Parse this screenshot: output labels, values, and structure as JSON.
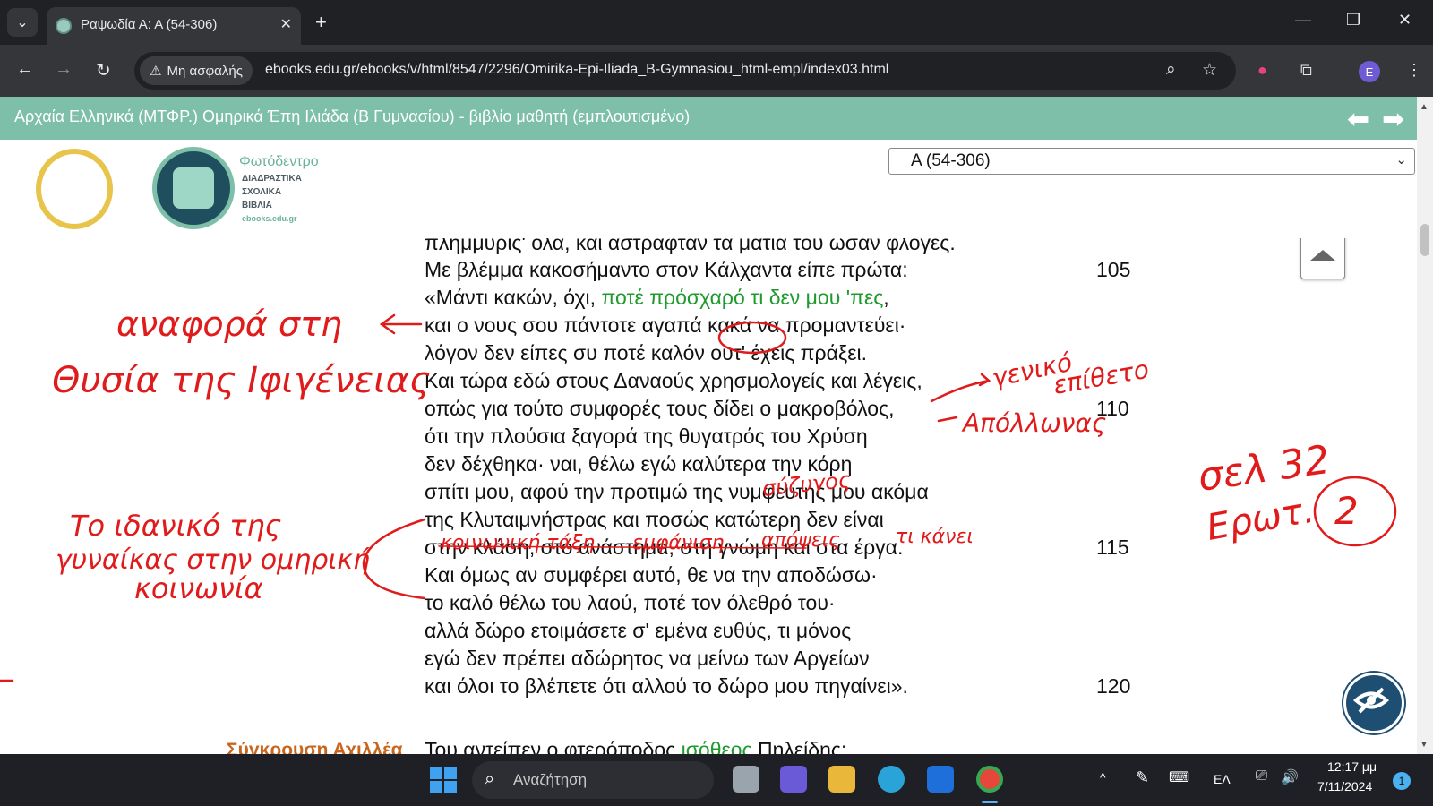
{
  "browser": {
    "tab_title": "Ραψωδία Α: Α (54-306)",
    "new_tab_symbol": "+",
    "security_label": "Μη ασφαλής",
    "url": "ebooks.edu.gr/ebooks/v/html/8547/2296/Omirika-Epi-Iliada_B-Gymnasiou_html-empl/index03.html",
    "profile_initial": "E"
  },
  "book": {
    "title": "Αρχαία Ελληνικά (ΜΤΦΡ.) Ομηρικά Έπη Ιλιάδα (Β Γυμνασίου) - βιβλίο μαθητή (εμπλουτισμένο)",
    "logo_title": "Φωτόδεντρο",
    "logo_sub1": "ΔΙΑΔΡΑΣΤΙΚΑ",
    "logo_sub2": "ΣΧΟΛΙΚΑ",
    "logo_sub3": "ΒΙΒΛΙΑ",
    "logo_sub4": "ebooks.edu.gr",
    "chapter_select": "Α (54-306)"
  },
  "verses": [
    {
      "text": "πλημμυρίς' όλα, και αστράφταν τα μάτια του ωσάν φλογές.",
      "num": ""
    },
    {
      "text": "Με βλέμμα κακοσήμαντο στον Κάλχαντα είπε πρώτα:",
      "num": "105"
    },
    {
      "pre": "«Μάντι κακών, όχι, ",
      "green": "ποτέ πρόσχαρό τι δεν μου 'πες",
      "post": ",",
      "num": ""
    },
    {
      "text": "και ο νους σου πάντοτε αγαπά κακά να προμαντεύει·",
      "num": ""
    },
    {
      "text": "λόγον δεν είπες συ ποτέ καλόν ουτ' έχεις πράξει.",
      "num": ""
    },
    {
      "text": "Και τώρα εδώ στους Δαναούς χρησμολογείς και λέγεις,",
      "num": ""
    },
    {
      "text": "οπώς για τούτο συμφορές τους δίδει ο μακροβόλος,",
      "num": "110"
    },
    {
      "text": "ότι την πλούσια ξαγορά της θυγατρός του Χρύση",
      "num": ""
    },
    {
      "text": "δεν δέχθηκα· ναι, θέλω εγώ καλύτερα την κόρη",
      "num": ""
    },
    {
      "text": "σπίτι μου, αφού την προτιμώ της νυμφευτής μου ακόμα",
      "num": ""
    },
    {
      "text": "της Κλυταιμνήστρας και ποσώς κατώτερη δεν είναι",
      "num": ""
    },
    {
      "text": "στην κλάση, στο ανάστημα, στη γνώμη και στα έργα.",
      "num": "115"
    },
    {
      "text": "Και όμως αν συμφέρει αυτό, θε να την αποδώσω·",
      "num": ""
    },
    {
      "text": "το καλό θέλω του λαού, ποτέ τον όλεθρό του·",
      "num": ""
    },
    {
      "text": "αλλά δώρο ετοιμάσετε σ' εμένα ευθύς, τι μόνος",
      "num": ""
    },
    {
      "text": "εγώ δεν πρέπει αδώρητος να μείνω των Αργείων",
      "num": ""
    },
    {
      "text": "και όλοι το βλέπετε ότι αλλού το δώρο μου πηγαίνει».",
      "num": "120"
    },
    {
      "pre": "Του αντείπεν ο φτερόποδος ",
      "green": "ισόθεος",
      "post": " Πηλείδης:",
      "num": ""
    }
  ],
  "section_label": "Σύγκρουση Αχιλλέα",
  "annotations": {
    "note1_line1": "αναφορά στη",
    "note1_line2": "Θυσία της Ιφιγένειας",
    "note2_line1": "γενικό",
    "note2_line2": "επίθετο",
    "note2_line3": "Απόλλωνας",
    "note3_line1": "σελ 32",
    "note3_line2": "Ερωτ.",
    "note3_num": "2",
    "note4": "σύζυγος",
    "note5_line1": "Το ιδανικό της",
    "note5_line2": "γυναίκας στην ομηρική",
    "note5_line3": "κοινωνία",
    "note6_a": "κοινωνική τάξη",
    "note6_b": "εμφάνιση",
    "note6_c": "απόψεις",
    "note6_d": "τι κάνει"
  },
  "taskbar": {
    "search_placeholder": "Αναζήτηση",
    "language": "ΕΛ",
    "time": "12:17 μμ",
    "date": "7/11/2024",
    "notification_count": "1"
  },
  "colors": {
    "header_green": "#7dbfa9",
    "ink_red": "#e01b1b",
    "link_green": "#1f9a2e",
    "section_orange": "#c8661d"
  }
}
